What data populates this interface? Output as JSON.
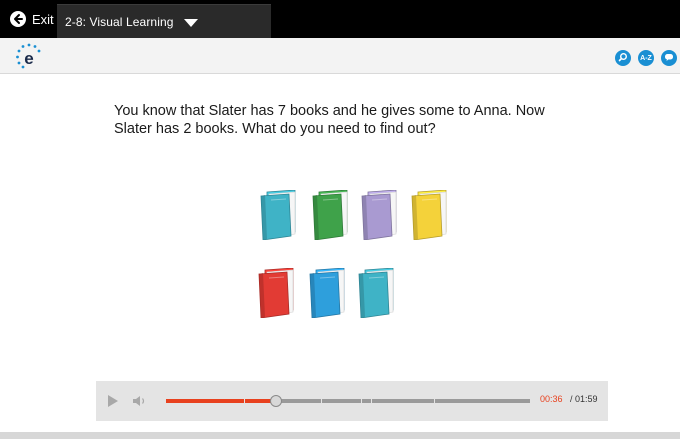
{
  "header": {
    "exit_label": "Exit",
    "lesson_title": "2-8: Visual Learning"
  },
  "toolbar": {
    "logo_letter": "e",
    "buttons": [
      {
        "name": "search",
        "label": ""
      },
      {
        "name": "glossary",
        "label": "A-Z"
      },
      {
        "name": "chat",
        "label": ""
      }
    ]
  },
  "lesson": {
    "question": "You know that Slater has 7 books and he gives some to Anna. Now Slater has 2 books. What do you need to find out?",
    "books": [
      {
        "color": "#3fb3c6",
        "row": 1
      },
      {
        "color": "#3fa24a",
        "row": 1
      },
      {
        "color": "#a99ad1",
        "row": 1
      },
      {
        "color": "#f4d23a",
        "row": 1
      },
      {
        "color": "#e23b34",
        "row": 2
      },
      {
        "color": "#2e9fdc",
        "row": 2
      },
      {
        "color": "#3fb3c6",
        "row": 2
      }
    ]
  },
  "player": {
    "current_time": "00:36",
    "total_time": "/ 01:59",
    "progress": 0.303,
    "accent": "#e8411e"
  }
}
